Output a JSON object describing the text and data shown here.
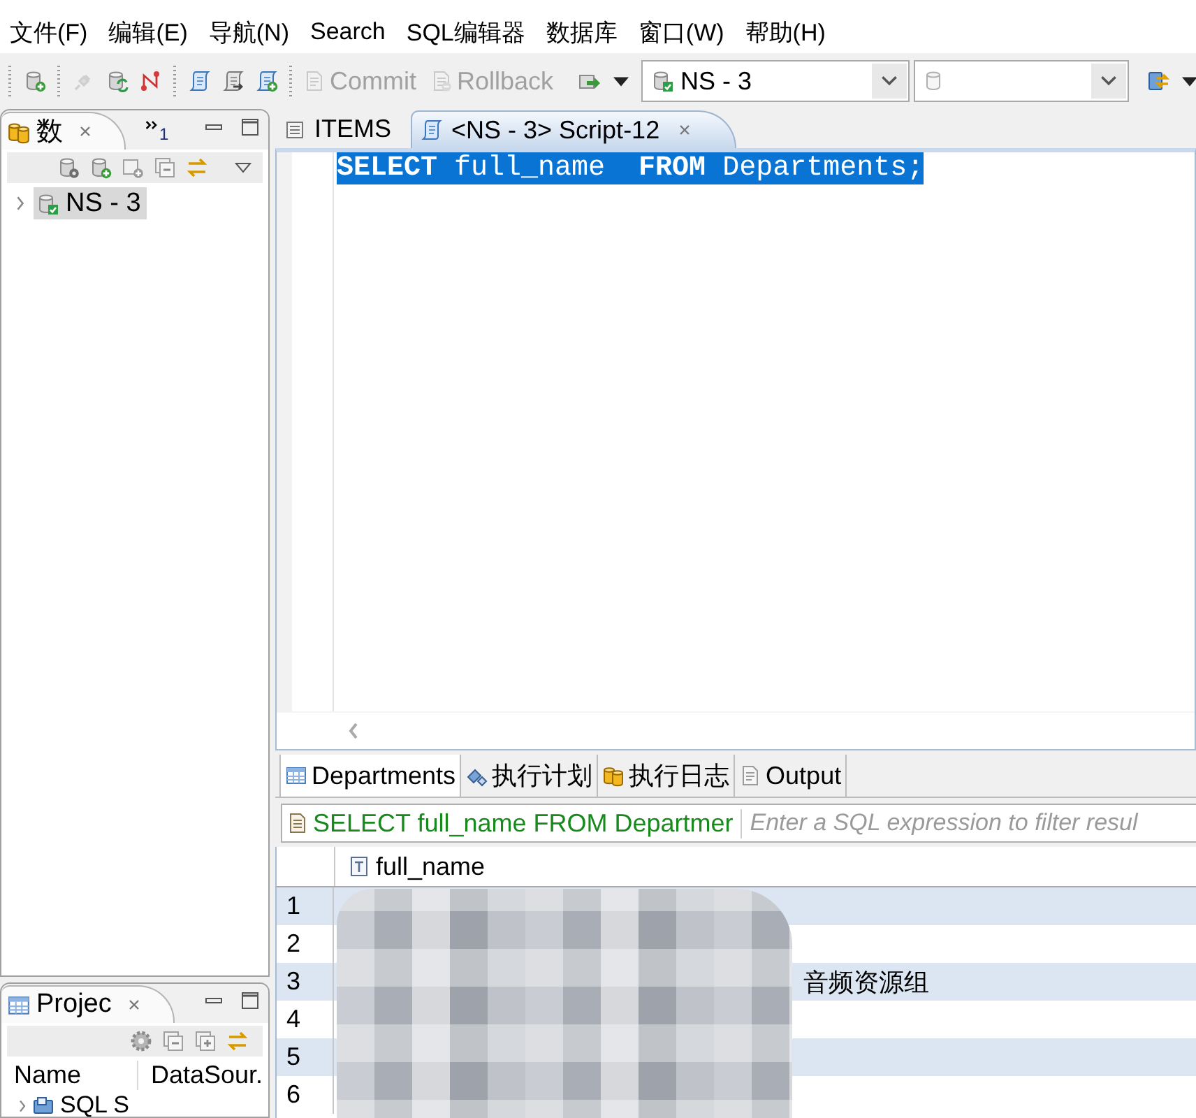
{
  "menu": [
    "文件(F)",
    "编辑(E)",
    "导航(N)",
    "Search",
    "SQL编辑器",
    "数据库",
    "窗口(W)",
    "帮助(H)"
  ],
  "toolbar": {
    "tools": [
      {
        "kind": "connect",
        "disabled": false
      },
      {
        "kind": "disconnect",
        "disabled": true
      },
      {
        "kind": "reconnect",
        "disabled": false
      },
      {
        "kind": "transaction",
        "disabled": false
      },
      {
        "kind": "script",
        "disabled": false
      },
      {
        "kind": "open",
        "disabled": false
      },
      {
        "kind": "new",
        "disabled": false
      }
    ],
    "actions": [
      {
        "kind": "commit",
        "label": "Commit",
        "disabled": true
      },
      {
        "kind": "rollback",
        "label": "Rollback",
        "disabled": true
      }
    ],
    "connection": {
      "value": "NS - 3"
    }
  },
  "navigator": {
    "tab": {
      "label": "数",
      "selected": true
    },
    "overflow_count": "1",
    "tree": [
      {
        "label": "NS - 3",
        "selected": true,
        "expanded": false
      }
    ]
  },
  "projects": {
    "tab": {
      "label": "Projec",
      "selected": true
    },
    "columns": [
      "Name",
      "DataSour."
    ],
    "tree": [
      {
        "label": "SQL S",
        "expanded": false
      }
    ]
  },
  "editor": {
    "tabs": [
      {
        "kind": "table",
        "label": "ITEMS",
        "selected": false
      },
      {
        "kind": "script",
        "label": "<NS - 3> Script-12",
        "selected": true
      }
    ],
    "lines": [
      {
        "text": "**SELECT** full_name  **FROM** Departments;",
        "selected": true
      }
    ]
  },
  "results": {
    "tabs": [
      {
        "kind": "table",
        "label": "Departments",
        "selected": true
      },
      {
        "kind": "plan",
        "label": "执行计划",
        "selected": false
      },
      {
        "kind": "log",
        "label": "执行日志",
        "selected": false
      },
      {
        "kind": "output",
        "label": "Output",
        "selected": false
      }
    ],
    "query": "SELECT full_name FROM Departmer",
    "filter": {
      "placeholder": "Enter a SQL expression to filter resul"
    },
    "columns": [
      "full_name"
    ],
    "rows": [
      {
        "number": "1"
      },
      {
        "number": "2"
      },
      {
        "number": "3",
        "value": "音频资源组"
      },
      {
        "number": "4"
      },
      {
        "number": "5"
      },
      {
        "number": "6"
      }
    ]
  }
}
